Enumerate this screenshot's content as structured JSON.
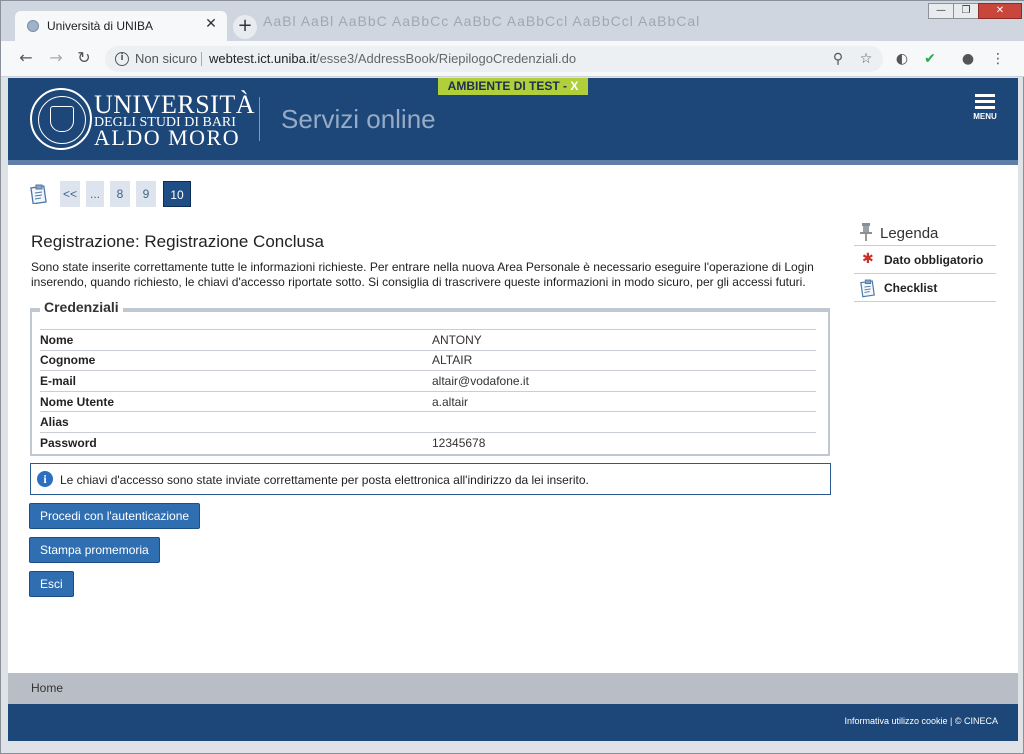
{
  "browser": {
    "tab_title": "Università di UNIBA",
    "tab_close": "✕",
    "new_tab": "+",
    "ghost_tabs": "AaBl  AaBl  AaBbC  AaBbCc  AaBbC  AaBbCcl  AaBbCcl  AaBbCal",
    "window_controls": {
      "minimize": "—",
      "maximize": "❐",
      "close": "✕"
    },
    "security_label": "Non sicuro",
    "url_host": "webtest.ict.uniba.it",
    "url_path": "/esse3/AddressBook/RiepilogoCredenziali.do",
    "icons": [
      "back-icon",
      "forward-icon",
      "reload-icon",
      "info-icon",
      "zoom-icon",
      "star-icon",
      "extension-icon",
      "shield-extension-icon",
      "profile-icon",
      "kebab-menu-icon"
    ]
  },
  "header": {
    "test_badge": "AMBIENTE DI TEST - ",
    "test_badge_x": "X",
    "logo_line1": "UNIVERSITÀ",
    "logo_line2": "DEGLI STUDI DI BARI",
    "logo_line3": "ALDO MORO",
    "site_title": "Servizi online",
    "menu_label": "MENU"
  },
  "pager": {
    "items": [
      "<<",
      "...",
      "8",
      "9",
      "10"
    ],
    "active": "10"
  },
  "main": {
    "title": "Registrazione: Registrazione Conclusa",
    "intro": "Sono state inserite correttamente tutte le informazioni richieste. Per entrare nella nuova Area Personale è necessario eseguire l'operazione di Login inserendo, quando richiesto, le chiavi d'accesso riportate sotto. Si consiglia di trascrivere queste informazioni in modo sicuro, per gli accessi futuri.",
    "credentials_legend": "Credenziali",
    "credentials": [
      {
        "label": "Nome",
        "value": "ANTONY"
      },
      {
        "label": "Cognome",
        "value": "ALTAIR"
      },
      {
        "label": "E-mail",
        "value": "altair@vodafone.it"
      },
      {
        "label": "Nome Utente",
        "value": "a.altair"
      },
      {
        "label": "Alias",
        "value": ""
      },
      {
        "label": "Password",
        "value": "12345678"
      }
    ],
    "notice": "Le chiavi d'accesso sono state inviate correttamente per posta elettronica all'indirizzo da lei inserito.",
    "buttons": {
      "login": "Procedi con l'autenticazione",
      "print": "Stampa promemoria",
      "exit": "Esci"
    }
  },
  "legenda": {
    "title": "Legenda",
    "items": [
      {
        "icon": "required-star-icon",
        "label": "Dato obbligatorio"
      },
      {
        "icon": "checklist-icon",
        "label": "Checklist"
      }
    ]
  },
  "footer": {
    "home": "Home",
    "credits": "Informativa utilizzo cookie | © CINECA"
  },
  "colors": {
    "brand_blue": "#1c4778",
    "button_blue": "#2f6fb1",
    "test_badge": "#b0cf3a",
    "required_star": "#c9302c"
  }
}
